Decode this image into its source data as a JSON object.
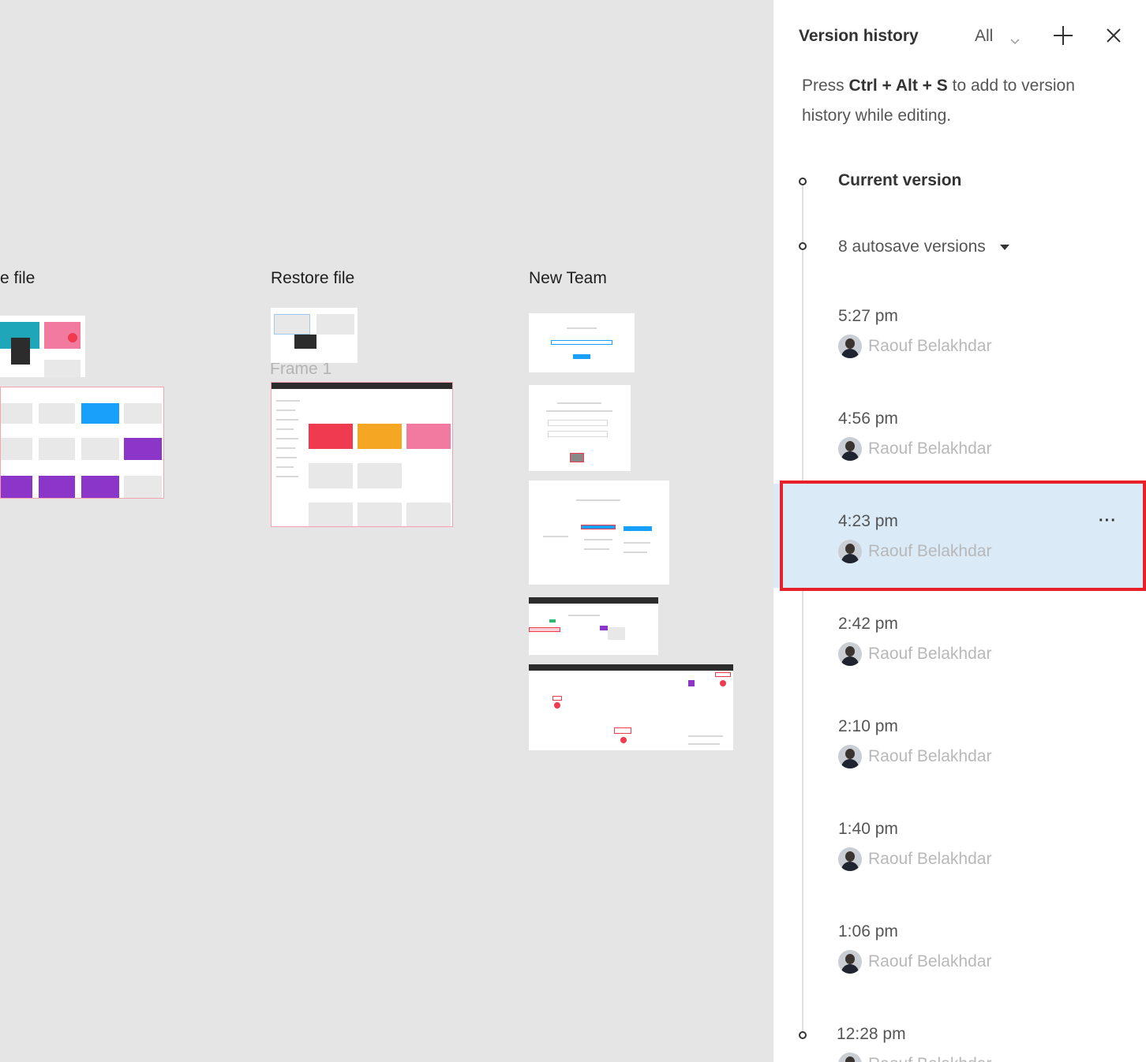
{
  "canvas": {
    "frames": [
      {
        "label": "e file"
      },
      {
        "label": "Restore file"
      },
      {
        "label": "Frame 1"
      },
      {
        "label": "New Team"
      }
    ]
  },
  "panel": {
    "title": "Version history",
    "filter": {
      "selected": "All"
    },
    "hint": {
      "prefix": "Press ",
      "shortcut": "Ctrl + Alt + S",
      "suffix": " to add to version history while editing."
    },
    "current_version": "Current version",
    "autosave": "8 autosave versions",
    "versions": [
      {
        "time": "5:27 pm",
        "author": "Raouf Belakhdar"
      },
      {
        "time": "4:56 pm",
        "author": "Raouf Belakhdar"
      },
      {
        "time": "4:23 pm",
        "author": "Raouf Belakhdar",
        "selected": true
      },
      {
        "time": "2:42 pm",
        "author": "Raouf Belakhdar"
      },
      {
        "time": "2:10 pm",
        "author": "Raouf Belakhdar"
      },
      {
        "time": "1:40 pm",
        "author": "Raouf Belakhdar"
      },
      {
        "time": "1:06 pm",
        "author": "Raouf Belakhdar"
      },
      {
        "time": "12:28 pm",
        "author": "Raouf Belakhdar"
      }
    ],
    "more_label": "···"
  },
  "colors": {
    "canvas_bg": "#e5e5e5",
    "selected_bg": "#daeaf7",
    "highlight": "#e8202a"
  }
}
